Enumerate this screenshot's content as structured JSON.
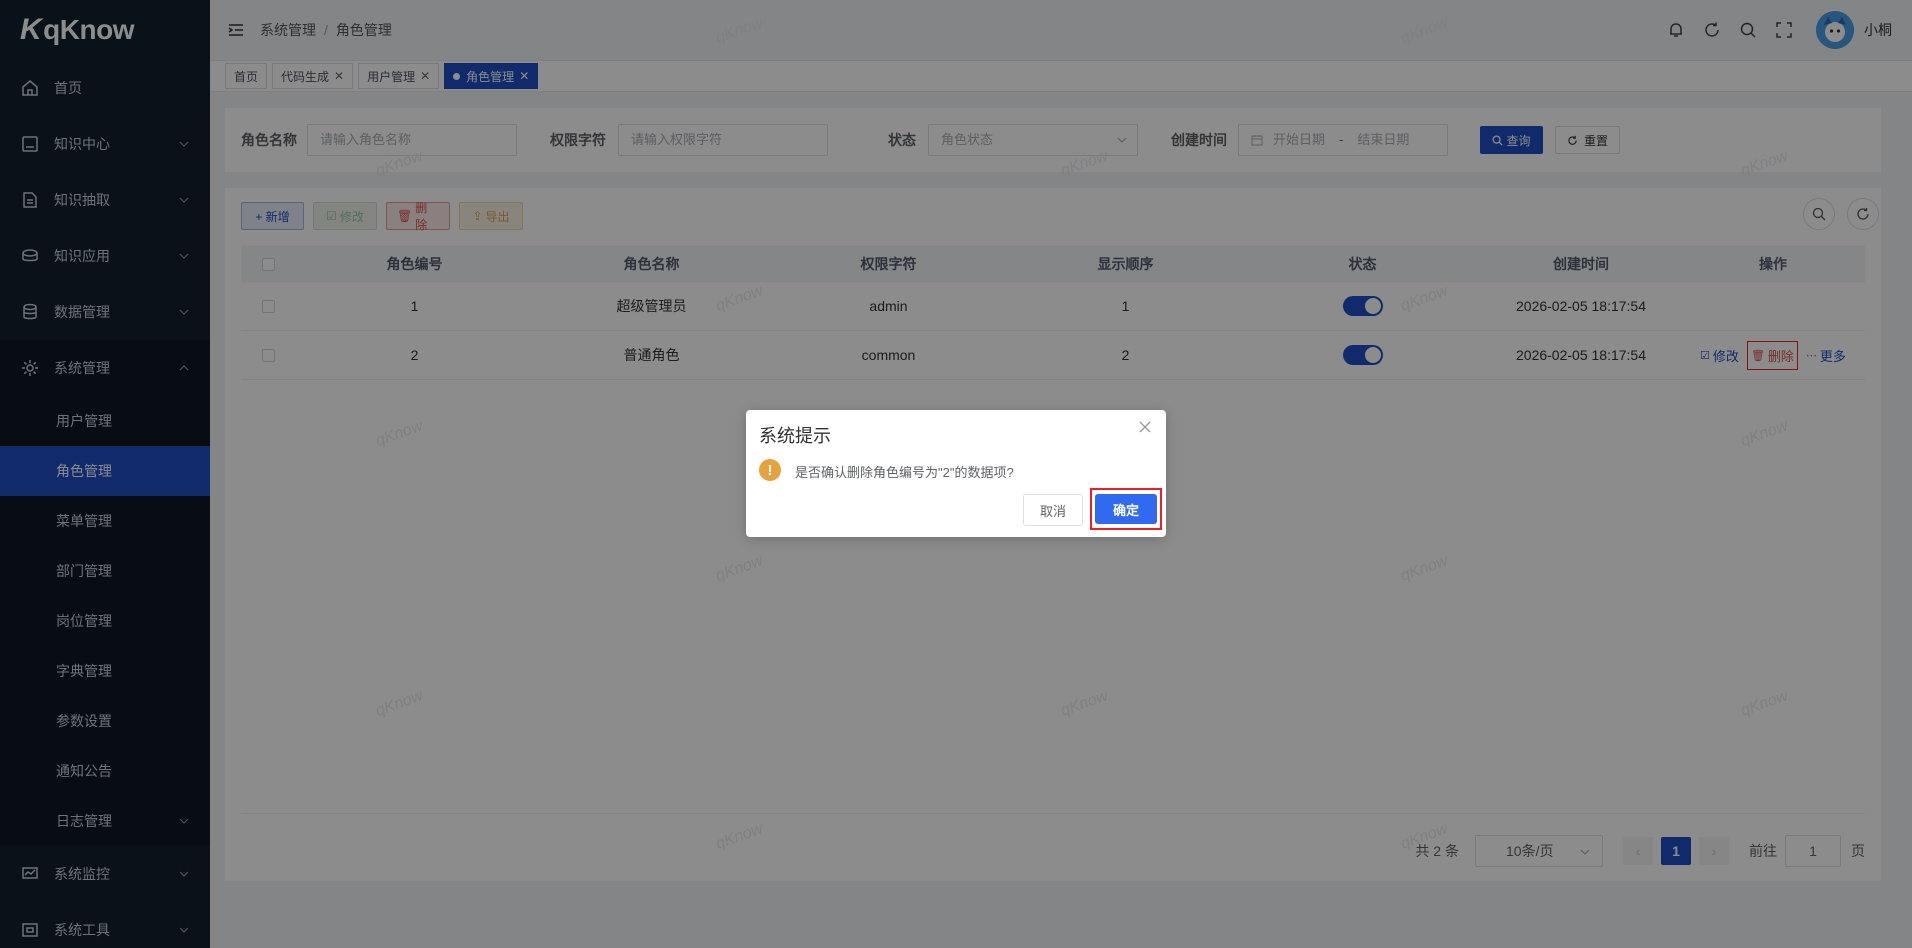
{
  "app": {
    "logo_text": "qKnow"
  },
  "sidebar": {
    "items": [
      {
        "label": "首页",
        "icon": "home-icon"
      },
      {
        "label": "知识中心",
        "icon": "book-icon"
      },
      {
        "label": "知识抽取",
        "icon": "document-icon"
      },
      {
        "label": "知识应用",
        "icon": "cube-stack-icon"
      },
      {
        "label": "数据管理",
        "icon": "database-icon"
      },
      {
        "label": "系统管理",
        "icon": "gear-icon"
      }
    ],
    "sub_items": [
      {
        "label": "用户管理"
      },
      {
        "label": "角色管理"
      },
      {
        "label": "菜单管理"
      },
      {
        "label": "部门管理"
      },
      {
        "label": "岗位管理"
      },
      {
        "label": "字典管理"
      },
      {
        "label": "参数设置"
      },
      {
        "label": "通知公告"
      },
      {
        "label": "日志管理"
      }
    ],
    "bottom_items": [
      {
        "label": "系统监控",
        "icon": "monitor-icon"
      },
      {
        "label": "系统工具",
        "icon": "tools-icon"
      }
    ]
  },
  "header": {
    "breadcrumb": [
      "系统管理",
      "角色管理"
    ],
    "username": "小桐"
  },
  "tags": [
    {
      "label": "首页",
      "closable": false,
      "active": false
    },
    {
      "label": "代码生成",
      "closable": true,
      "active": false
    },
    {
      "label": "用户管理",
      "closable": true,
      "active": false
    },
    {
      "label": "角色管理",
      "closable": true,
      "active": true
    }
  ],
  "search": {
    "role_name_label": "角色名称",
    "role_name_placeholder": "请输入角色名称",
    "perm_label": "权限字符",
    "perm_placeholder": "请输入权限字符",
    "status_label": "状态",
    "status_placeholder": "角色状态",
    "time_label": "创建时间",
    "start_placeholder": "开始日期",
    "range_sep": "-",
    "end_placeholder": "结束日期",
    "query_label": "查询",
    "reset_label": "重置"
  },
  "toolbar": {
    "add_label": "+ 新增",
    "edit_label": "修改",
    "delete_label": "删除",
    "export_label": "导出"
  },
  "table": {
    "headers": [
      "角色编号",
      "角色名称",
      "权限字符",
      "显示顺序",
      "状态",
      "创建时间",
      "操作"
    ],
    "rows": [
      {
        "id": "1",
        "name": "超级管理员",
        "key": "admin",
        "order": "1",
        "status": true,
        "created": "2026-02-05 18:17:54",
        "ops": false
      },
      {
        "id": "2",
        "name": "普通角色",
        "key": "common",
        "order": "2",
        "status": true,
        "created": "2026-02-05 18:17:54",
        "ops": true
      }
    ],
    "op_edit": "修改",
    "op_delete": "删除",
    "op_more": "更多"
  },
  "pagination": {
    "total": "共 2 条",
    "page_size": "10条/页",
    "current": "1",
    "goto_label": "前往",
    "goto_value": "1",
    "page_suffix": "页"
  },
  "watermark": "qKnow",
  "dialog": {
    "title": "系统提示",
    "message": "是否确认删除角色编号为\"2\"的数据项?",
    "cancel": "取消",
    "confirm": "确定"
  },
  "colors": {
    "primary": "#1e4ec4",
    "sidebar_bg": "#12202f",
    "highlight": "#e8202a",
    "warning": "#e6a23c"
  }
}
